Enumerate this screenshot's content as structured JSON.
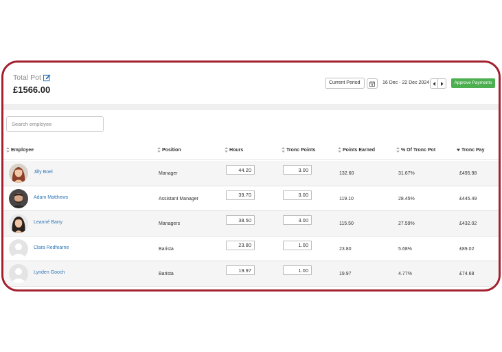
{
  "header": {
    "pot_label": "Total Pot",
    "pot_value": "£1566.00",
    "current_period_label": "Current Period",
    "date_range": "16 Dec - 22 Dec 2024",
    "approve_label": "Approve Payments"
  },
  "search": {
    "placeholder": "Search employee"
  },
  "colors": {
    "frame": "#a3202f",
    "approve": "#4caf50",
    "link": "#2d76b8"
  },
  "table": {
    "columns": {
      "employee": "Employee",
      "position": "Position",
      "hours": "Hours",
      "tronc_points": "Tronc Points",
      "points_earned": "Points Earned",
      "pct_tronc_pot": "% Of Tronc Pot",
      "tronc_pay": "Tronc Pay"
    },
    "rows": [
      {
        "name": "Jilly Boel",
        "position": "Manager",
        "hours": "44.20",
        "tronc_points": "3.00",
        "points_earned": "132.60",
        "pct": "31.67%",
        "pay": "£495.98",
        "avatar": "photo"
      },
      {
        "name": "Adam Matthews",
        "position": "Assistant Manager",
        "hours": "39.70",
        "tronc_points": "3.00",
        "points_earned": "119.10",
        "pct": "28.45%",
        "pay": "£445.49",
        "avatar": "photo"
      },
      {
        "name": "Leanné Barry",
        "position": "Managers",
        "hours": "38.50",
        "tronc_points": "3.00",
        "points_earned": "115.50",
        "pct": "27.59%",
        "pay": "£432.02",
        "avatar": "photo"
      },
      {
        "name": "Clara Redfearne",
        "position": "Barista",
        "hours": "23.80",
        "tronc_points": "1.00",
        "points_earned": "23.80",
        "pct": "5.68%",
        "pay": "£89.02",
        "avatar": "placeholder"
      },
      {
        "name": "Lynden Gooch",
        "position": "Barista",
        "hours": "19.97",
        "tronc_points": "1.00",
        "points_earned": "19.97",
        "pct": "4.77%",
        "pay": "£74.68",
        "avatar": "placeholder"
      }
    ]
  }
}
